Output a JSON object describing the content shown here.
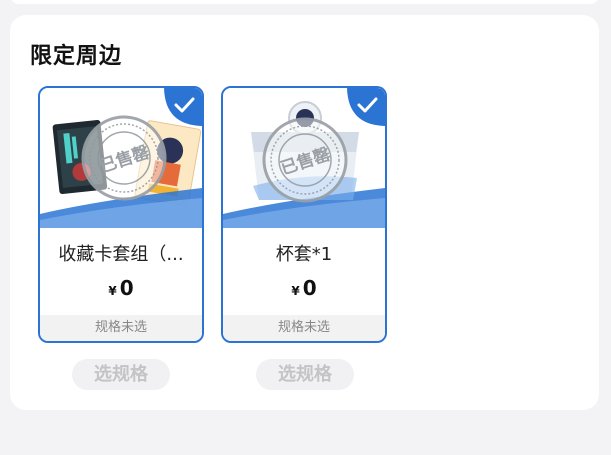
{
  "section": {
    "title": "限定周边"
  },
  "products": [
    {
      "name": "收藏卡套组（...",
      "currency": "¥",
      "price": "0",
      "spec": "规格未选",
      "stamp": "已售罄",
      "selected": true,
      "select_label": "选规格"
    },
    {
      "name": "杯套*1",
      "currency": "¥",
      "price": "0",
      "spec": "规格未选",
      "stamp": "已售罄",
      "selected": true,
      "select_label": "选规格"
    }
  ],
  "colors": {
    "accent": "#2b74d4",
    "stamp": "#9aa0a6"
  }
}
